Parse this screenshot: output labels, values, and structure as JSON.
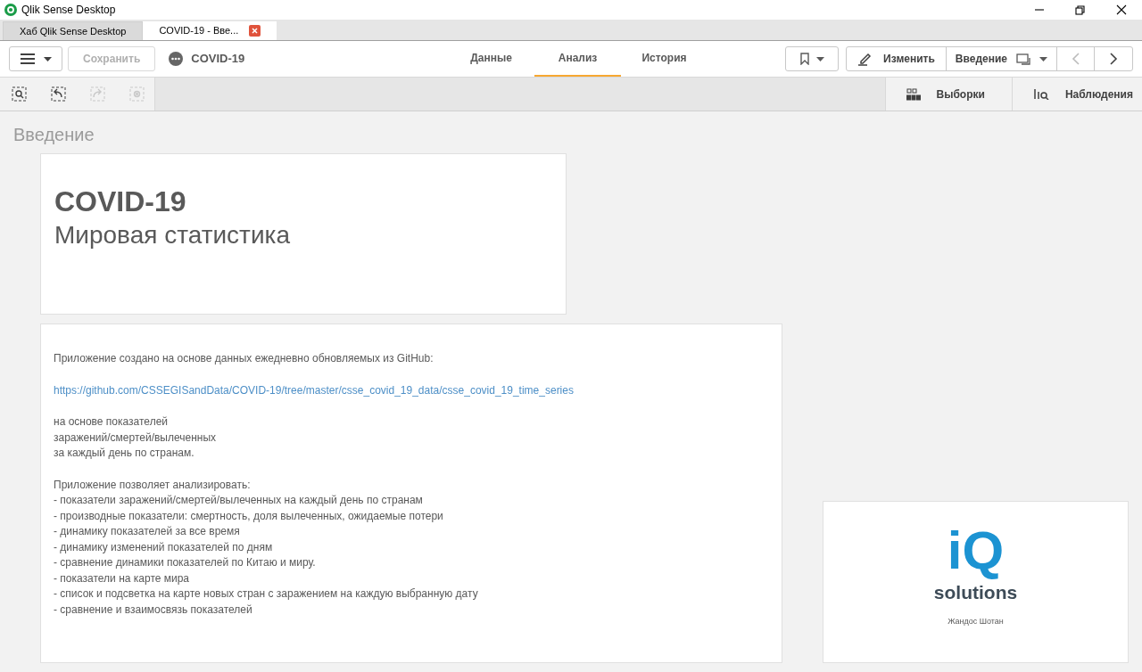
{
  "window": {
    "title": "Qlik Sense Desktop"
  },
  "browser_tabs": [
    {
      "label": "Хаб Qlik Sense Desktop",
      "selected": false,
      "closable": false
    },
    {
      "label": "COVID-19 - Вве...",
      "selected": true,
      "closable": true
    }
  ],
  "toolbar": {
    "save_button": "Сохранить",
    "app_name": "COVID-19",
    "edit_button": "Изменить",
    "sheet_button": "Введение",
    "nav_tabs": [
      {
        "label": "Данные",
        "selected": false
      },
      {
        "label": "Анализ",
        "selected": true
      },
      {
        "label": "История",
        "selected": false
      }
    ],
    "prev_disabled": true,
    "next_disabled": false
  },
  "selection_tools": [
    {
      "kind": "lasso",
      "disabled": false
    },
    {
      "kind": "back",
      "disabled": false
    },
    {
      "kind": "forward",
      "disabled": true
    },
    {
      "kind": "clear",
      "disabled": true
    }
  ],
  "panel_buttons": [
    {
      "kind": "selections",
      "label": "Выборки"
    },
    {
      "kind": "insights",
      "label": "Наблюдения"
    }
  ],
  "sheet": {
    "title": "Введение",
    "title_card": {
      "heading": "COVID-19",
      "subtitle": "Мировая статистика"
    },
    "text_card": {
      "paragraphs": [
        {
          "kind": "text",
          "lines": [
            "Приложение создано на основе данных ежедневно обновляемых из GitHub:"
          ]
        },
        {
          "kind": "link",
          "lines": [
            "https://github.com/CSSEGISandData/COVID-19/tree/master/csse_covid_19_data/csse_covid_19_time_series"
          ]
        },
        {
          "kind": "text",
          "lines": [
            "на основе показателей",
            "заражений/смертей/вылеченных",
            "за каждый день по странам."
          ]
        },
        {
          "kind": "text",
          "lines": [
            "Приложение позволяет анализировать:",
            "- показатели заражений/смертей/вылеченных на каждый день по странам",
            "- производные показатели: смертность, доля вылеченных, ожидаемые потери",
            "- динамику показателей за все время",
            "- динамику изменений показателей по дням",
            "- сравнение динамики показателей по Китаю и миру.",
            "- показатели на карте мира",
            "- список и подсветка на карте новых стран с заражением на каждую выбранную дату",
            "- сравнение и взаимосвязь показателей"
          ]
        }
      ]
    },
    "logo_card": {
      "logo_mark": "iQ",
      "logo_word": "solutions",
      "caption": "Жандос Шотан"
    }
  }
}
